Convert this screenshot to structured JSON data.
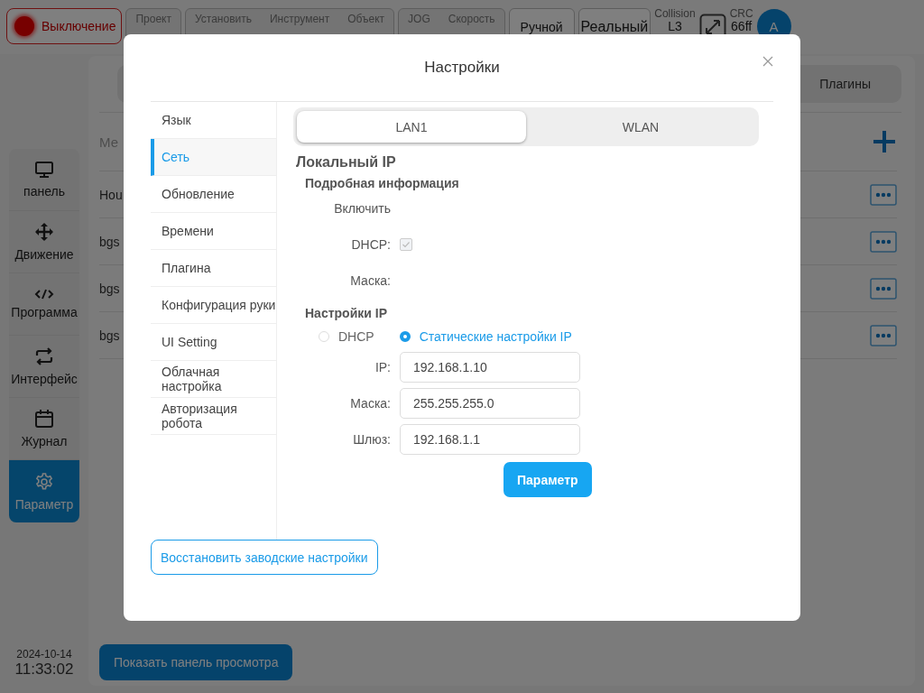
{
  "topbar": {
    "power_button": {
      "label": "Выключение"
    },
    "status_groups": [
      [
        {
          "label": "Проект"
        }
      ],
      [
        {
          "label": "Установить"
        },
        {
          "label": "Инструмент"
        },
        {
          "label": "Объект"
        }
      ],
      [
        {
          "label": "JOG"
        },
        {
          "label": "Скорость"
        }
      ]
    ],
    "mode_buttons": [
      "Ручной",
      "Реальный"
    ],
    "collision": {
      "label": "Collision",
      "value": "L3"
    },
    "crc": {
      "label": "CRC",
      "value": "66ff"
    },
    "avatar": "A"
  },
  "sidebar": {
    "items": [
      {
        "kind": "monitor",
        "label": "панель",
        "selected": false
      },
      {
        "kind": "move",
        "label": "Движение",
        "selected": false
      },
      {
        "kind": "code",
        "label": "Программа",
        "selected": false
      },
      {
        "kind": "swap",
        "label": "Интерфейс",
        "selected": false
      },
      {
        "kind": "calendar",
        "label": "Журнал",
        "selected": false
      },
      {
        "kind": "gear",
        "label": "Параметр",
        "selected": true
      }
    ],
    "date": "2024-10-14",
    "time": "11:33:02"
  },
  "main": {
    "tab": "Плагины",
    "column_1": "Ме",
    "rows": [
      "Hou",
      "bgs",
      "bgs",
      "bgs"
    ],
    "preview_button": "Показать панель просмотра"
  },
  "dialog": {
    "title": "Настройки",
    "menu": [
      {
        "label": "Язык",
        "selected": false
      },
      {
        "label": "Сеть",
        "selected": true
      },
      {
        "label": "Обновление",
        "selected": false
      },
      {
        "label": "Времени",
        "selected": false
      },
      {
        "label": "Плагина",
        "selected": false
      },
      {
        "label": "Конфигурация руки",
        "selected": false
      },
      {
        "label": "UI Setting",
        "selected": false
      },
      {
        "label": "Облачная настройка",
        "selected": false
      },
      {
        "label": "Авторизация робота",
        "selected": false
      }
    ],
    "tabs": [
      {
        "label": "LAN1",
        "selected": true
      },
      {
        "label": "WLAN",
        "selected": false
      }
    ],
    "section_title": "Локальный IP",
    "details_title": "Подробная информация",
    "enable_label": "Включить",
    "dhcp": {
      "label": "DHCP:",
      "checked": true
    },
    "mask_label": "Маска:",
    "ip_title": "Настройки IP",
    "modes": [
      {
        "label": "DHCP",
        "selected": false
      },
      {
        "label": "Статические настройки IP",
        "selected": true
      }
    ],
    "fields": [
      {
        "label": "IP:",
        "value": "192.168.1.10"
      },
      {
        "label": "Маска:",
        "value": "255.255.255.0"
      },
      {
        "label": "Шлюз:",
        "value": "192.168.1.1"
      }
    ],
    "apply_button": "Параметр",
    "reset_button": "Восстановить заводские настройки"
  }
}
